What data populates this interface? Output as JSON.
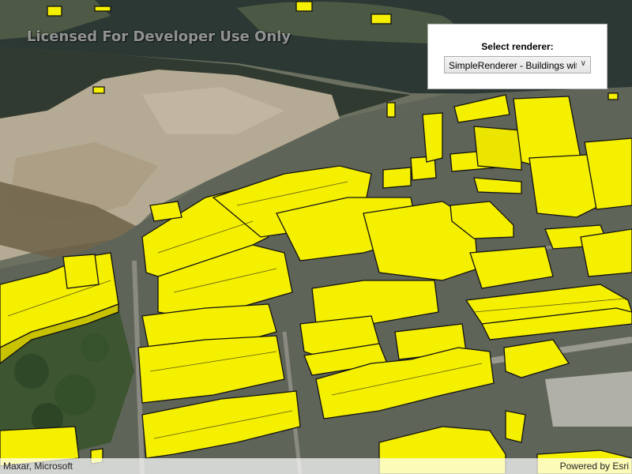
{
  "watermark": {
    "text": "Licensed For Developer Use Only"
  },
  "renderer_panel": {
    "title": "Select renderer:",
    "selected_value": "SimpleRenderer - Buildings without edges",
    "dropdown_arrow_icon": "chevron-down-icon"
  },
  "attribution": {
    "credits": "Maxar, Microsoft",
    "powered_by": "Powered by Esri"
  },
  "colors": {
    "building_fill": "#f5ef00",
    "building_edge": "#111111",
    "water": "#2e3a33",
    "sand": "#b8ad96",
    "vegetation": "#3f5a32"
  }
}
